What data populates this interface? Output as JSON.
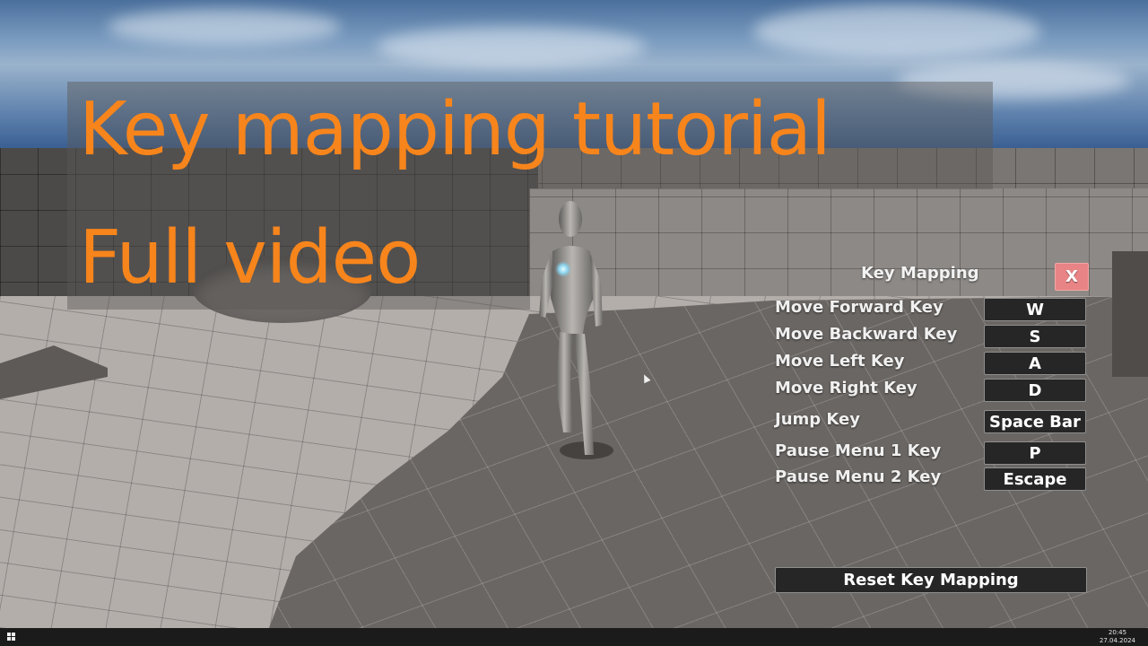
{
  "overlay_title": {
    "line1": "Key mapping tutorial",
    "line2": "Full video",
    "color": "#f7851c"
  },
  "key_mapping_panel": {
    "title": "Key Mapping",
    "close_label": "X",
    "close_color": "#e88485",
    "rows": [
      {
        "label": "Move Forward Key",
        "key": "W"
      },
      {
        "label": "Move Backward Key",
        "key": "S"
      },
      {
        "label": "Move Left Key",
        "key": "A"
      },
      {
        "label": "Move Right Key",
        "key": "D"
      },
      {
        "label": "Jump Key",
        "key": "Space Bar"
      },
      {
        "label": "Pause Menu 1 Key",
        "key": "P"
      },
      {
        "label": "Pause Menu 2 Key",
        "key": "Escape"
      }
    ],
    "reset_label": "Reset Key Mapping"
  },
  "taskbar": {
    "start_icon": "windows-start-icon",
    "time": "20:45",
    "date": "27.04.2024"
  },
  "scene": {
    "character": "mannequin-character",
    "cursor": "mouse-pointer"
  }
}
